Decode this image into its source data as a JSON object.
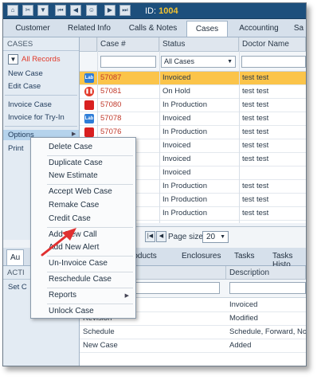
{
  "toolbar": {
    "buttons": [
      "home-icon",
      "tools-icon",
      "filter-icon",
      "first-page-icon",
      "previous-page-icon",
      "users-icon",
      "next-page-icon",
      "last-page-icon"
    ],
    "id_label": "ID:",
    "id_value": "1004"
  },
  "tabs": [
    "Customer",
    "Related Info",
    "Calls & Notes",
    "Cases",
    "Accounting",
    "Sa"
  ],
  "active_tab": "Cases",
  "left_panel": {
    "header": "CASES",
    "all_records": "All Records",
    "items": [
      "New Case",
      "Edit Case",
      "Invoice Case",
      "Invoice for Try-In",
      "Options",
      "Print"
    ]
  },
  "grid": {
    "columns": [
      "Case #",
      "Status",
      "Doctor Name"
    ],
    "status_filter": "All Cases",
    "rows": [
      {
        "icon": "lab-icon",
        "case": "57087",
        "status": "Invoiced",
        "doctor": "test test",
        "selected": true
      },
      {
        "icon": "hold-icon",
        "case": "57081",
        "status": "On Hold",
        "doctor": "test test"
      },
      {
        "icon": "stop-icon",
        "case": "57080",
        "status": "In Production",
        "doctor": "test test"
      },
      {
        "icon": "lab-icon",
        "case": "57078",
        "status": "Invoiced",
        "doctor": "test test"
      },
      {
        "icon": "stop-icon",
        "case": "57076",
        "status": "In Production",
        "doctor": "test test"
      },
      {
        "icon": "",
        "case": "",
        "status": "Invoiced",
        "doctor": "test test"
      },
      {
        "icon": "",
        "case": "",
        "status": "Invoiced",
        "doctor": "test test"
      },
      {
        "icon": "",
        "case": "",
        "status": "Invoiced",
        "doctor": ""
      },
      {
        "icon": "",
        "case": "",
        "status": "In Production",
        "doctor": "test test"
      },
      {
        "icon": "",
        "case": "",
        "status": "In Production",
        "doctor": "test test"
      },
      {
        "icon": "",
        "case": "",
        "status": "In Production",
        "doctor": "test test"
      }
    ]
  },
  "pager": {
    "page_size_label": "Page size:",
    "page_size": "20"
  },
  "bottom_tabs": [
    "Au",
    "roducts",
    "Enclosures",
    "Tasks",
    "Tasks Histo"
  ],
  "bottom_left": {
    "header": "ACTI",
    "items": [
      "Set C"
    ]
  },
  "bottom_grid": {
    "columns": [
      "Description"
    ],
    "rows": [
      {
        "left": "",
        "description": "Invoiced"
      },
      {
        "left": "Revision",
        "description": "Modified"
      },
      {
        "left": "Schedule",
        "description": "Schedule, Forward, Normal"
      },
      {
        "left": "New Case",
        "description": "Added"
      }
    ]
  },
  "context_menu": {
    "items": [
      "Delete Case",
      "Duplicate Case",
      "New Estimate",
      "Accept Web Case",
      "Remake Case",
      "Credit Case",
      "Add New Call",
      "Add New Alert",
      "Un-Invoice Case",
      "Reschedule Case",
      "Reports",
      "Unlock Case"
    ]
  },
  "colors": {
    "toolbar": "#1d4f7c",
    "id_value": "#f2c230",
    "selected_row": "#fbc44a",
    "all_records": "#e23a2a",
    "annotation_arrow": "#e03030"
  }
}
